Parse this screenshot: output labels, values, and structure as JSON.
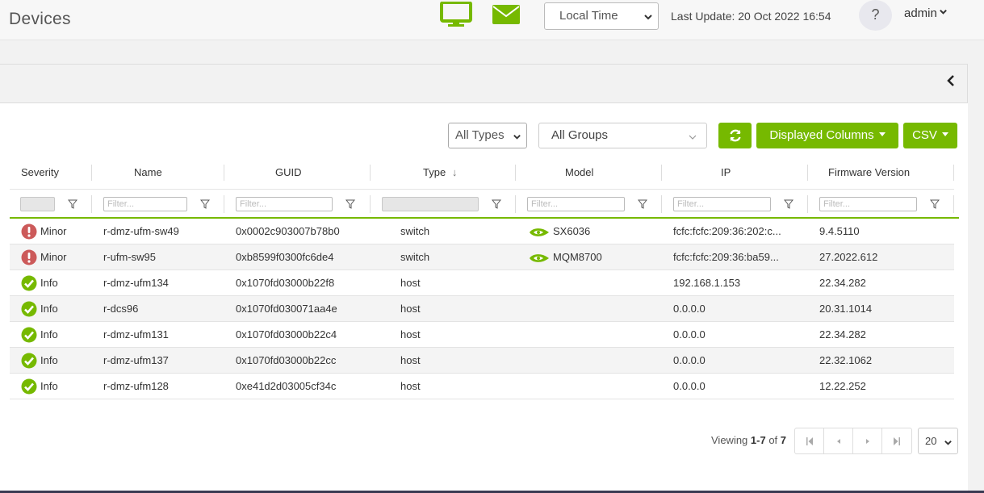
{
  "header": {
    "title": "Devices",
    "time_select_value": "Local Time",
    "last_update": "Last Update: 20 Oct 2022 16:54",
    "help_label": "?",
    "user": "admin",
    "accent_color": "#76b900"
  },
  "toolbar": {
    "type_filter": "All Types",
    "group_filter": "All Groups",
    "displayed_columns_label": "Displayed Columns",
    "csv_label": "CSV"
  },
  "table": {
    "columns": [
      "Severity",
      "Name",
      "GUID",
      "Type",
      "Model",
      "IP",
      "Firmware Version"
    ],
    "sort_indicator": "↓",
    "filter_placeholder": "Filter...",
    "rows": [
      {
        "severity": "Minor",
        "name": "r-dmz-ufm-sw49",
        "guid": "0x0002c903007b78b0",
        "type": "switch",
        "model": "SX6036",
        "ip": "fcfc:fcfc:209:36:202:c...",
        "firmware": "9.4.5110"
      },
      {
        "severity": "Minor",
        "name": "r-ufm-sw95",
        "guid": "0xb8599f0300fc6de4",
        "type": "switch",
        "model": "MQM8700",
        "ip": "fcfc:fcfc:209:36:ba59...",
        "firmware": "27.2022.612"
      },
      {
        "severity": "Info",
        "name": "r-dmz-ufm134",
        "guid": "0x1070fd03000b22f8",
        "type": "host",
        "model": "",
        "ip": "192.168.1.153",
        "firmware": "22.34.282"
      },
      {
        "severity": "Info",
        "name": "r-dcs96",
        "guid": "0x1070fd030071aa4e",
        "type": "host",
        "model": "",
        "ip": "0.0.0.0",
        "firmware": "20.31.1014"
      },
      {
        "severity": "Info",
        "name": "r-dmz-ufm131",
        "guid": "0x1070fd03000b22c4",
        "type": "host",
        "model": "",
        "ip": "0.0.0.0",
        "firmware": "22.34.282"
      },
      {
        "severity": "Info",
        "name": "r-dmz-ufm137",
        "guid": "0x1070fd03000b22cc",
        "type": "host",
        "model": "",
        "ip": "0.0.0.0",
        "firmware": "22.32.1062"
      },
      {
        "severity": "Info",
        "name": "r-dmz-ufm128",
        "guid": "0xe41d2d03005cf34c",
        "type": "host",
        "model": "",
        "ip": "0.0.0.0",
        "firmware": "12.22.252"
      }
    ]
  },
  "footer": {
    "viewing_prefix": "Viewing ",
    "viewing_range": "1-7",
    "viewing_of": " of ",
    "viewing_total": "7",
    "page_size": "20"
  },
  "icons": {
    "minor": "exclamation-circle-icon",
    "info": "check-circle-icon",
    "model": "nvidia-logo-icon"
  }
}
